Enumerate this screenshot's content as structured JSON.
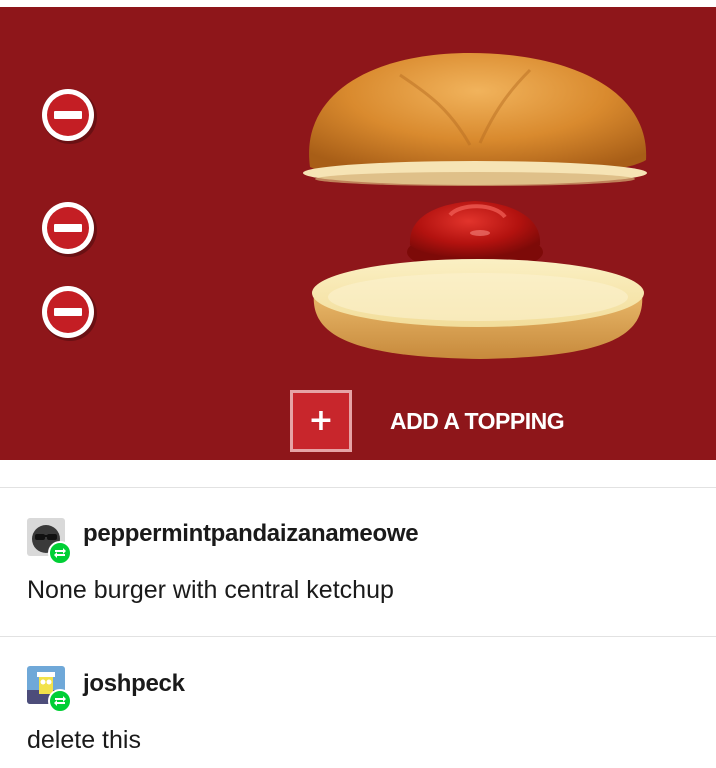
{
  "builder": {
    "background_color": "#8e161a",
    "remove_buttons": [
      {
        "name": "remove-top-bun",
        "icon": "minus-circle-icon"
      },
      {
        "name": "remove-ketchup",
        "icon": "minus-circle-icon"
      },
      {
        "name": "remove-bottom-bun",
        "icon": "minus-circle-icon"
      }
    ],
    "layers": [
      "top bun",
      "ketchup",
      "bottom bun"
    ],
    "add_button": {
      "icon": "plus-icon",
      "label": "ADD A TOPPING"
    }
  },
  "posts": [
    {
      "username": "peppermintpandaizanameowe",
      "text": "None burger with central ketchup",
      "avatar_icon": "sunglasses-avatar-icon",
      "badge_icon": "reblog-icon"
    },
    {
      "username": "joshpeck",
      "text": "delete this",
      "avatar_icon": "cartoon-avatar-icon",
      "badge_icon": "reblog-icon"
    }
  ],
  "colors": {
    "reblog_green": "#00cf35",
    "add_button_red": "#c8262c"
  }
}
